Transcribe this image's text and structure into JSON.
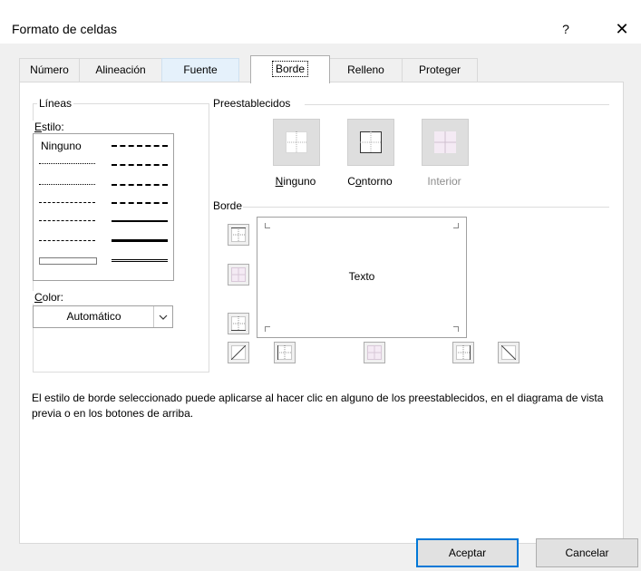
{
  "window": {
    "title": "Formato de celdas",
    "help_label": "?",
    "close_label": "✕"
  },
  "tabs": [
    {
      "label": "Número"
    },
    {
      "label": "Alineación"
    },
    {
      "label": "Fuente"
    },
    {
      "label": "Borde",
      "active": true
    },
    {
      "label": "Relleno"
    },
    {
      "label": "Proteger"
    }
  ],
  "lines": {
    "group_label": "Líneas",
    "style_label": "Estilo:",
    "style_none": "Ninguno",
    "color_label": "Color:",
    "color_value": "Automático"
  },
  "presets": {
    "group_label": "Preestablecidos",
    "items": [
      {
        "label": "Ninguno"
      },
      {
        "label": "Contorno"
      },
      {
        "label": "Interior",
        "disabled": true
      }
    ]
  },
  "border": {
    "group_label": "Borde",
    "preview_text": "Texto"
  },
  "hint": "El estilo de borde seleccionado puede aplicarse al hacer clic en alguno de los preestablecidos, en el diagrama de vista previa o en los botones de arriba.",
  "buttons": {
    "accept": "Aceptar",
    "cancel": "Cancelar"
  },
  "colors": {
    "accent": "#0078d7",
    "disabled_text": "#8c8c8c"
  }
}
